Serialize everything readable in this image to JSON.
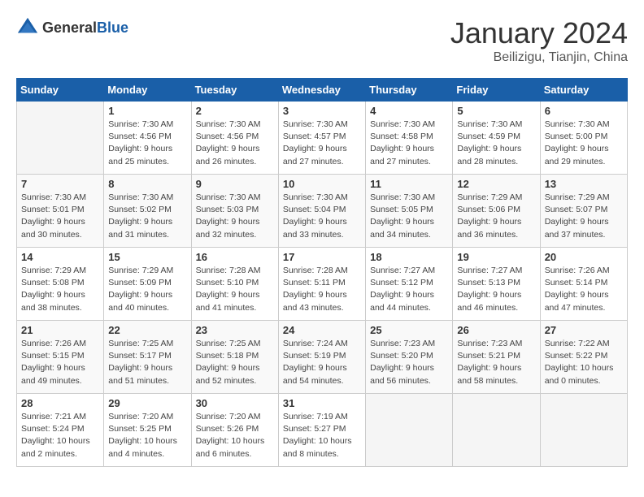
{
  "header": {
    "logo_general": "General",
    "logo_blue": "Blue",
    "month": "January 2024",
    "location": "Beilizigu, Tianjin, China"
  },
  "days_of_week": [
    "Sunday",
    "Monday",
    "Tuesday",
    "Wednesday",
    "Thursday",
    "Friday",
    "Saturday"
  ],
  "weeks": [
    [
      {
        "day": "",
        "info": ""
      },
      {
        "day": "1",
        "info": "Sunrise: 7:30 AM\nSunset: 4:56 PM\nDaylight: 9 hours\nand 25 minutes."
      },
      {
        "day": "2",
        "info": "Sunrise: 7:30 AM\nSunset: 4:56 PM\nDaylight: 9 hours\nand 26 minutes."
      },
      {
        "day": "3",
        "info": "Sunrise: 7:30 AM\nSunset: 4:57 PM\nDaylight: 9 hours\nand 27 minutes."
      },
      {
        "day": "4",
        "info": "Sunrise: 7:30 AM\nSunset: 4:58 PM\nDaylight: 9 hours\nand 27 minutes."
      },
      {
        "day": "5",
        "info": "Sunrise: 7:30 AM\nSunset: 4:59 PM\nDaylight: 9 hours\nand 28 minutes."
      },
      {
        "day": "6",
        "info": "Sunrise: 7:30 AM\nSunset: 5:00 PM\nDaylight: 9 hours\nand 29 minutes."
      }
    ],
    [
      {
        "day": "7",
        "info": "Sunrise: 7:30 AM\nSunset: 5:01 PM\nDaylight: 9 hours\nand 30 minutes."
      },
      {
        "day": "8",
        "info": "Sunrise: 7:30 AM\nSunset: 5:02 PM\nDaylight: 9 hours\nand 31 minutes."
      },
      {
        "day": "9",
        "info": "Sunrise: 7:30 AM\nSunset: 5:03 PM\nDaylight: 9 hours\nand 32 minutes."
      },
      {
        "day": "10",
        "info": "Sunrise: 7:30 AM\nSunset: 5:04 PM\nDaylight: 9 hours\nand 33 minutes."
      },
      {
        "day": "11",
        "info": "Sunrise: 7:30 AM\nSunset: 5:05 PM\nDaylight: 9 hours\nand 34 minutes."
      },
      {
        "day": "12",
        "info": "Sunrise: 7:29 AM\nSunset: 5:06 PM\nDaylight: 9 hours\nand 36 minutes."
      },
      {
        "day": "13",
        "info": "Sunrise: 7:29 AM\nSunset: 5:07 PM\nDaylight: 9 hours\nand 37 minutes."
      }
    ],
    [
      {
        "day": "14",
        "info": "Sunrise: 7:29 AM\nSunset: 5:08 PM\nDaylight: 9 hours\nand 38 minutes."
      },
      {
        "day": "15",
        "info": "Sunrise: 7:29 AM\nSunset: 5:09 PM\nDaylight: 9 hours\nand 40 minutes."
      },
      {
        "day": "16",
        "info": "Sunrise: 7:28 AM\nSunset: 5:10 PM\nDaylight: 9 hours\nand 41 minutes."
      },
      {
        "day": "17",
        "info": "Sunrise: 7:28 AM\nSunset: 5:11 PM\nDaylight: 9 hours\nand 43 minutes."
      },
      {
        "day": "18",
        "info": "Sunrise: 7:27 AM\nSunset: 5:12 PM\nDaylight: 9 hours\nand 44 minutes."
      },
      {
        "day": "19",
        "info": "Sunrise: 7:27 AM\nSunset: 5:13 PM\nDaylight: 9 hours\nand 46 minutes."
      },
      {
        "day": "20",
        "info": "Sunrise: 7:26 AM\nSunset: 5:14 PM\nDaylight: 9 hours\nand 47 minutes."
      }
    ],
    [
      {
        "day": "21",
        "info": "Sunrise: 7:26 AM\nSunset: 5:15 PM\nDaylight: 9 hours\nand 49 minutes."
      },
      {
        "day": "22",
        "info": "Sunrise: 7:25 AM\nSunset: 5:17 PM\nDaylight: 9 hours\nand 51 minutes."
      },
      {
        "day": "23",
        "info": "Sunrise: 7:25 AM\nSunset: 5:18 PM\nDaylight: 9 hours\nand 52 minutes."
      },
      {
        "day": "24",
        "info": "Sunrise: 7:24 AM\nSunset: 5:19 PM\nDaylight: 9 hours\nand 54 minutes."
      },
      {
        "day": "25",
        "info": "Sunrise: 7:23 AM\nSunset: 5:20 PM\nDaylight: 9 hours\nand 56 minutes."
      },
      {
        "day": "26",
        "info": "Sunrise: 7:23 AM\nSunset: 5:21 PM\nDaylight: 9 hours\nand 58 minutes."
      },
      {
        "day": "27",
        "info": "Sunrise: 7:22 AM\nSunset: 5:22 PM\nDaylight: 10 hours\nand 0 minutes."
      }
    ],
    [
      {
        "day": "28",
        "info": "Sunrise: 7:21 AM\nSunset: 5:24 PM\nDaylight: 10 hours\nand 2 minutes."
      },
      {
        "day": "29",
        "info": "Sunrise: 7:20 AM\nSunset: 5:25 PM\nDaylight: 10 hours\nand 4 minutes."
      },
      {
        "day": "30",
        "info": "Sunrise: 7:20 AM\nSunset: 5:26 PM\nDaylight: 10 hours\nand 6 minutes."
      },
      {
        "day": "31",
        "info": "Sunrise: 7:19 AM\nSunset: 5:27 PM\nDaylight: 10 hours\nand 8 minutes."
      },
      {
        "day": "",
        "info": ""
      },
      {
        "day": "",
        "info": ""
      },
      {
        "day": "",
        "info": ""
      }
    ]
  ]
}
